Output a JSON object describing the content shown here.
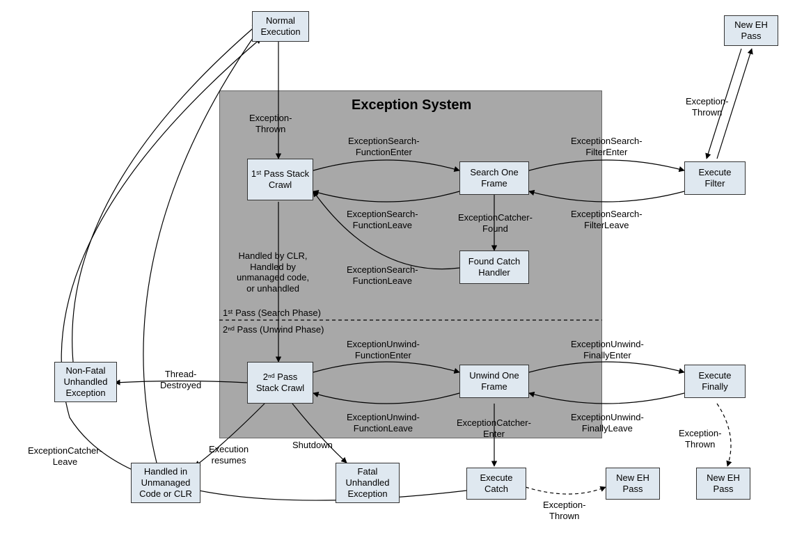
{
  "title": "Exception System",
  "phases": {
    "search": "1ˢᵗ Pass (Search Phase)",
    "unwind": "2ⁿᵈ Pass (Unwind Phase)"
  },
  "nodes": {
    "normal_exec": "Normal\nExecution",
    "new_eh_top": "New EH\nPass",
    "pass1": "1ˢᵗ Pass\nStack Crawl",
    "search_one": "Search One\nFrame",
    "exec_filter": "Execute\nFilter",
    "found_catch": "Found Catch\nHandler",
    "pass2": "2ⁿᵈ Pass\nStack Crawl",
    "unwind_one": "Unwind One\nFrame",
    "exec_finally": "Execute\nFinally",
    "nonfatal": "Non-Fatal\nUnhandled\nException",
    "unmanaged": "Handled in\nUnmanaged\nCode or CLR",
    "fatal": "Fatal\nUnhandled\nException",
    "exec_catch": "Execute\nCatch",
    "new_eh_b1": "New EH\nPass",
    "new_eh_b2": "New EH\nPass"
  },
  "edges": {
    "exception_thrown": "Exception-\nThrown",
    "es_func_enter": "ExceptionSearch-\nFunctionEnter",
    "es_func_leave": "ExceptionSearch-\nFunctionLeave",
    "es_filter_enter": "ExceptionSearch-\nFilterEnter",
    "es_filter_leave": "ExceptionSearch-\nFilterLeave",
    "ec_found": "ExceptionCatcher-\nFound",
    "es_func_leave2": "ExceptionSearch-\nFunctionLeave",
    "handled_clr": "Handled by CLR,\nHandled by\nunmanaged code,\nor unhandled",
    "eu_func_enter": "ExceptionUnwind-\nFunctionEnter",
    "eu_func_leave": "ExceptionUnwind-\nFunctionLeave",
    "eu_finally_enter": "ExceptionUnwind-\nFinallyEnter",
    "eu_finally_leave": "ExceptionUnwind-\nFinallyLeave",
    "ec_enter": "ExceptionCatcher-\nEnter",
    "thread_destroyed": "Thread-\nDestroyed",
    "shutdown": "Shutdown",
    "exec_resumes": "Execution\nresumes",
    "ec_leave": "ExceptionCatcher-\nLeave",
    "exception_thrown2": "Exception-\nThrown",
    "exception_thrown3": "Exception-\nThrown",
    "exception_thrown4": "Exception-\nThrown"
  }
}
